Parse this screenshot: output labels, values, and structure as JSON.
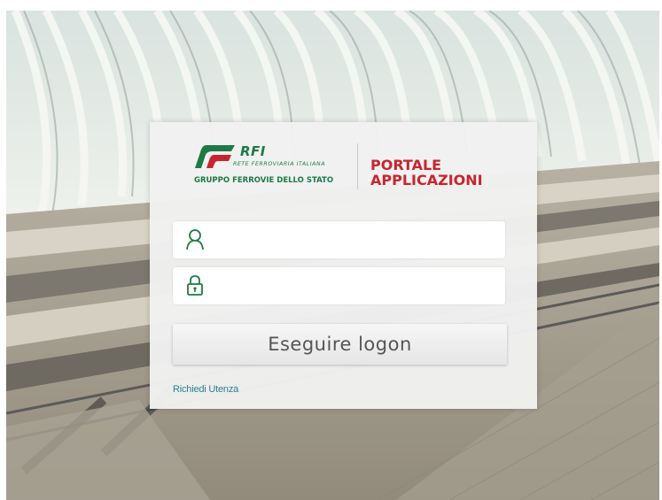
{
  "brand": {
    "logo_name": "RFI",
    "logo_subtitle": "RETE FERROVIARIA ITALIANA",
    "group_name": "GRUPPO FERROVIE DELLO STATO",
    "portal_title_line1": "PORTALE",
    "portal_title_line2": "APPLICAZIONI",
    "green_color": "#1d7a45",
    "red_color": "#c7252f"
  },
  "login": {
    "username_icon": "user-icon",
    "password_icon": "lock-icon",
    "username_value": "",
    "password_value": "",
    "submit_label": "Eseguire logon",
    "request_link_label": "Richiedi Utenza"
  }
}
